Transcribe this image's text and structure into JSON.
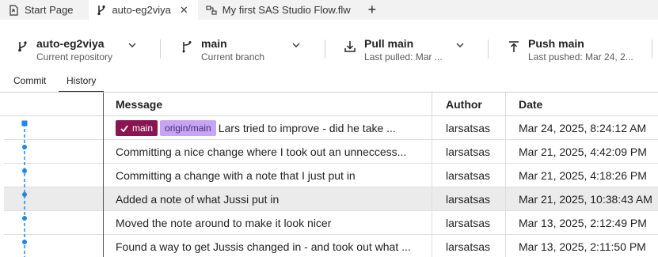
{
  "tabs": [
    {
      "label": "Start Page",
      "icon": "start-page-icon",
      "active": false
    },
    {
      "label": "auto-eg2viya",
      "icon": "git-branch-icon",
      "active": true,
      "closable": true
    },
    {
      "label": "My first SAS Studio Flow.flw",
      "icon": "flow-icon",
      "active": false
    }
  ],
  "tab_close": "✕",
  "tab_add": "+",
  "toolbar": {
    "repository": {
      "title": "auto-eg2viya",
      "subtitle": "Current repository"
    },
    "branch": {
      "title": "main",
      "subtitle": "Current branch"
    },
    "pull": {
      "title": "Pull main",
      "subtitle": "Last pulled: Mar ..."
    },
    "push": {
      "title": "Push main",
      "subtitle": "Last pushed: Mar 24, 2..."
    }
  },
  "subtabs": {
    "commit": "Commit",
    "history": "History",
    "active": "history"
  },
  "table": {
    "headers": {
      "message": "Message",
      "author": "Author",
      "date": "Date"
    },
    "rows": [
      {
        "badges": {
          "main": "main",
          "origin": "origin/main"
        },
        "message": "Lars tried to improve - did he take ...",
        "author": "larsatsas",
        "date": "Mar 24, 2025, 8:24:12 AM"
      },
      {
        "message": "Committing a nice change where I took out an unneccess...",
        "author": "larsatsas",
        "date": "Mar 21, 2025, 4:42:09 PM"
      },
      {
        "message": "Committing a change with a note that I just put in",
        "author": "larsatsas",
        "date": "Mar 21, 2025, 4:18:26 PM"
      },
      {
        "message": "Added a note of what Jussi put in",
        "author": "larsatsas",
        "date": "Mar 21, 2025, 10:38:43 AM",
        "selected": true
      },
      {
        "message": "Moved the note around to make it look nicer",
        "author": "larsatsas",
        "date": "Mar 13, 2025, 2:12:49 PM"
      },
      {
        "message": "Found a way to get Jussis changed in - and took out what ...",
        "author": "larsatsas",
        "date": "Mar 13, 2025, 2:11:50 PM"
      }
    ]
  },
  "colors": {
    "graph": "#1e88e5",
    "main_badge": "#8a1551",
    "origin_badge": "#c6a6f2",
    "selected_row": "#ebebeb"
  }
}
